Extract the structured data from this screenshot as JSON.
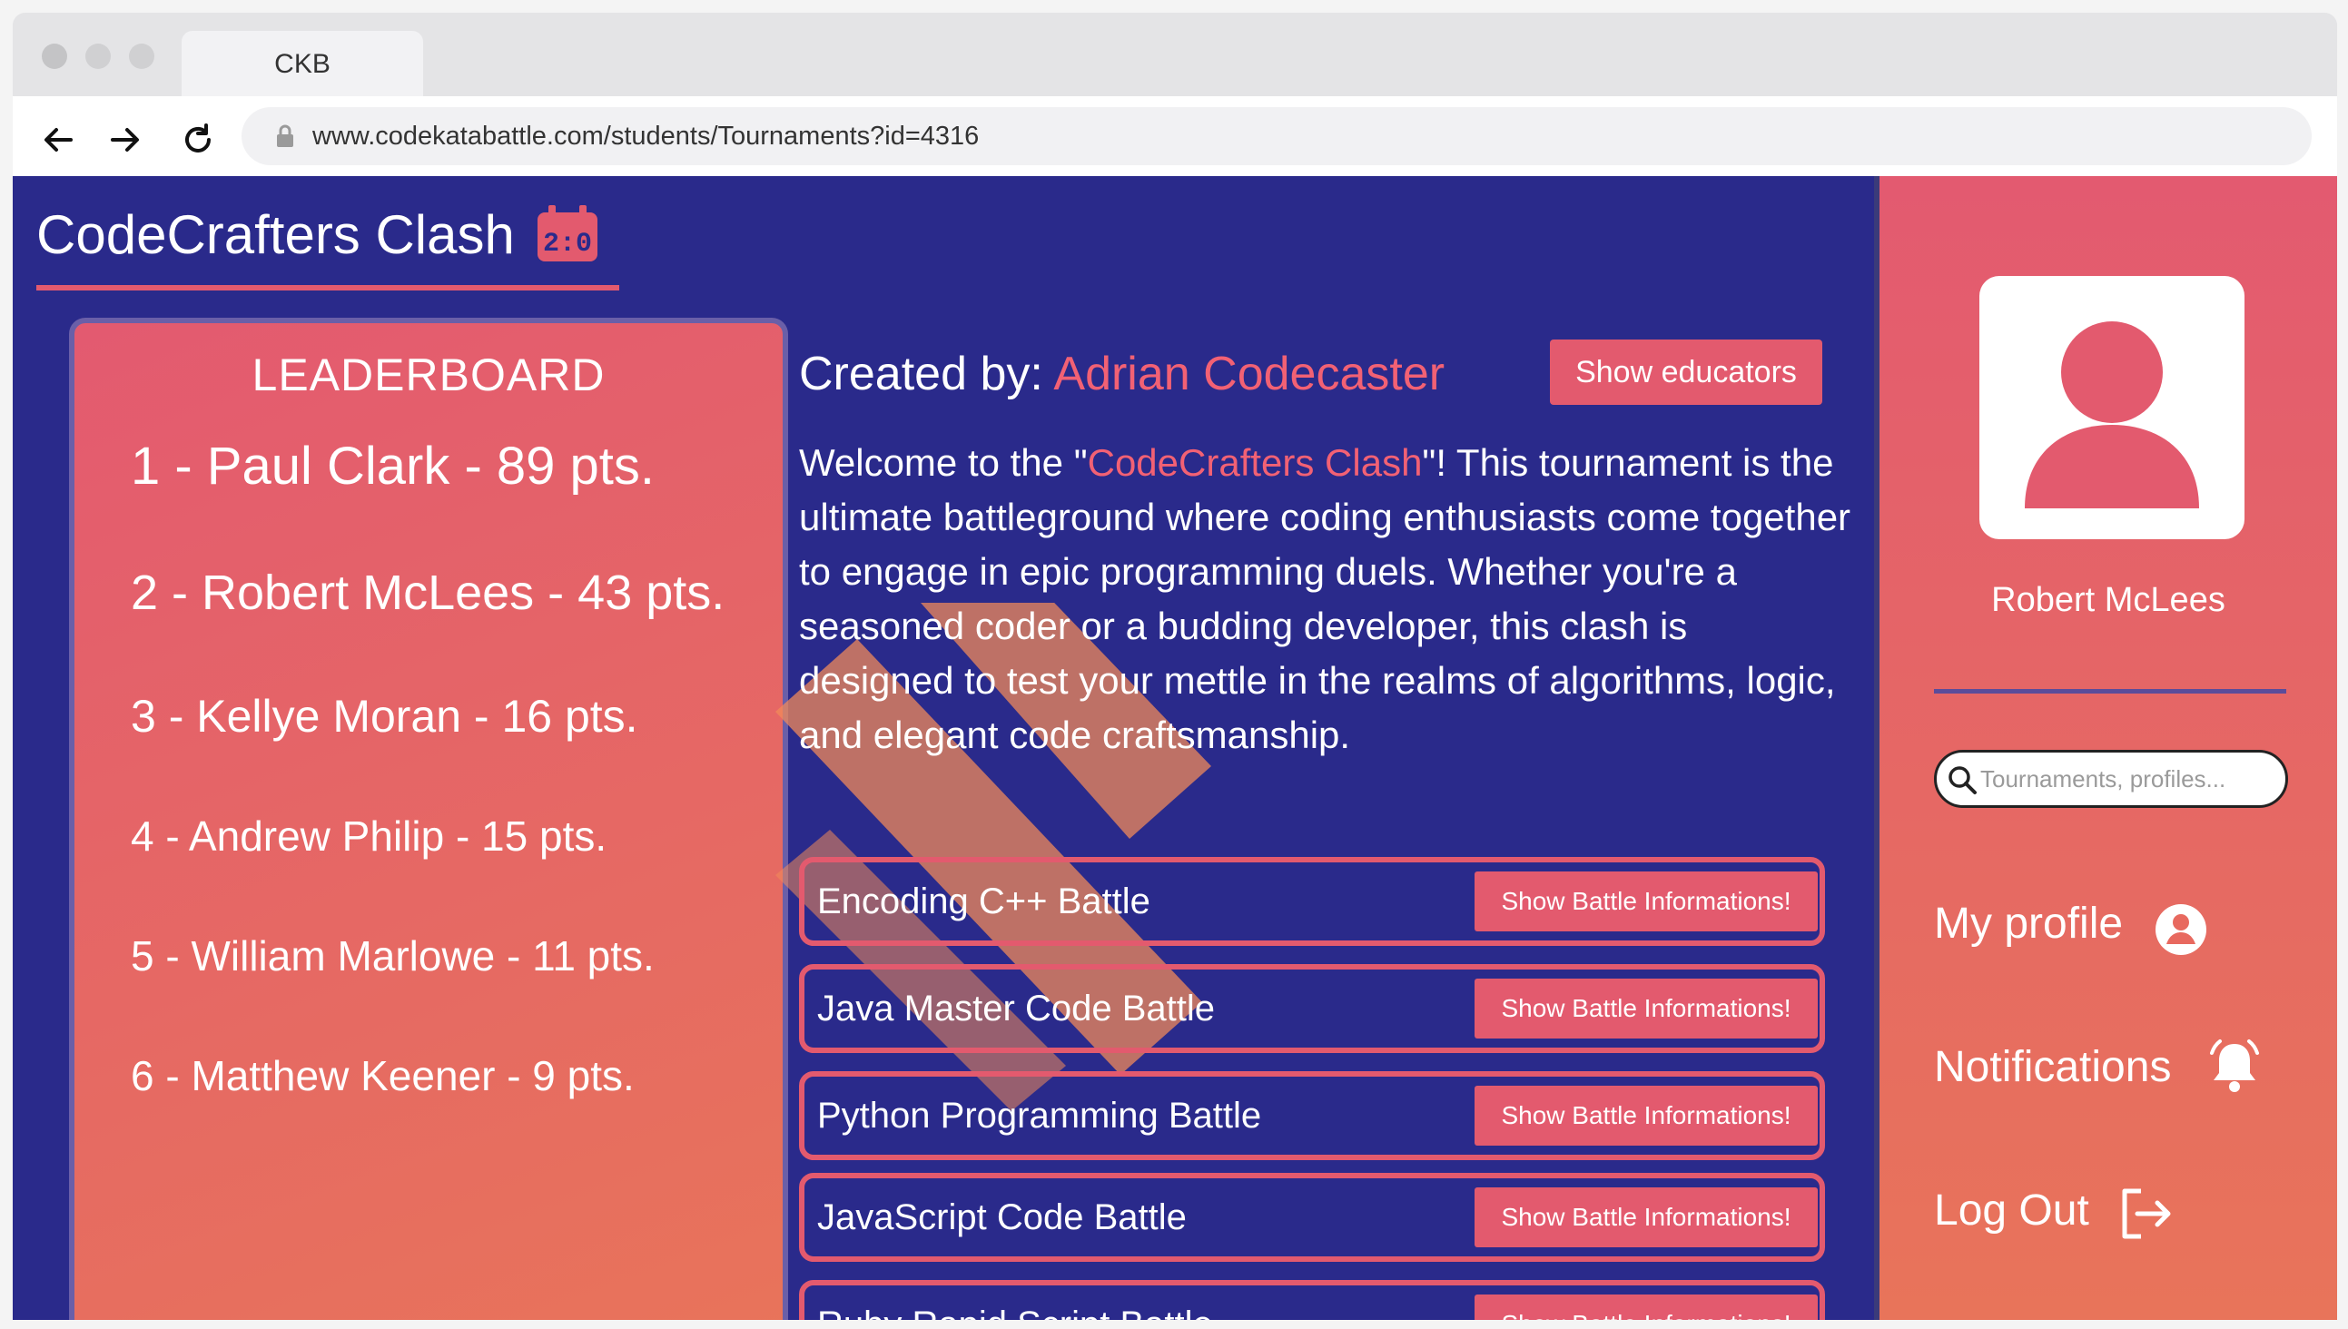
{
  "browser": {
    "tab_title": "CKB",
    "url": "www.codekatabattle.com/students/Tournaments?id=4316"
  },
  "page": {
    "title": "CodeCrafters Clash",
    "title_icon": "tournament-calendar-icon"
  },
  "leaderboard": {
    "title": "LEADERBOARD",
    "entries": [
      "1 - Paul Clark  -  89 pts.",
      "2 - Robert McLees  -  43 pts.",
      "3 - Kellye Moran  -  16 pts.",
      "4 - Andrew Philip  -  15 pts.",
      "5 - William Marlowe  -  11 pts.",
      "6 - Matthew Keener  -  9 pts."
    ]
  },
  "main": {
    "created_by_label": "Created by: ",
    "creator_name": "Adrian Codecaster",
    "show_educators_label": "Show educators",
    "description_before": "Welcome to the \"",
    "description_highlight": "CodeCrafters Clash",
    "description_after": "\"! This tournament is the ultimate battleground where coding enthusiasts come together to engage in epic programming duels. Whether you're a seasoned coder or a budding developer, this clash is designed to test your mettle in the realms of algorithms, logic, and elegant code craftsmanship.",
    "battle_button_label": "Show Battle Informations!",
    "battles": [
      "Encoding C++ Battle",
      "Java Master Code Battle",
      "Python Programming Battle",
      "JavaScript Code Battle",
      "Ruby Rapid Script Battle"
    ]
  },
  "sidebar": {
    "user_name": "Robert McLees",
    "search_placeholder": "Tournaments, profiles...",
    "menu": {
      "profile": "My profile",
      "notifications": "Notifications",
      "logout": "Log Out"
    }
  },
  "colors": {
    "background": "#2a2a8b",
    "accent": "#e35a6e",
    "highlight_text": "#f26174"
  }
}
